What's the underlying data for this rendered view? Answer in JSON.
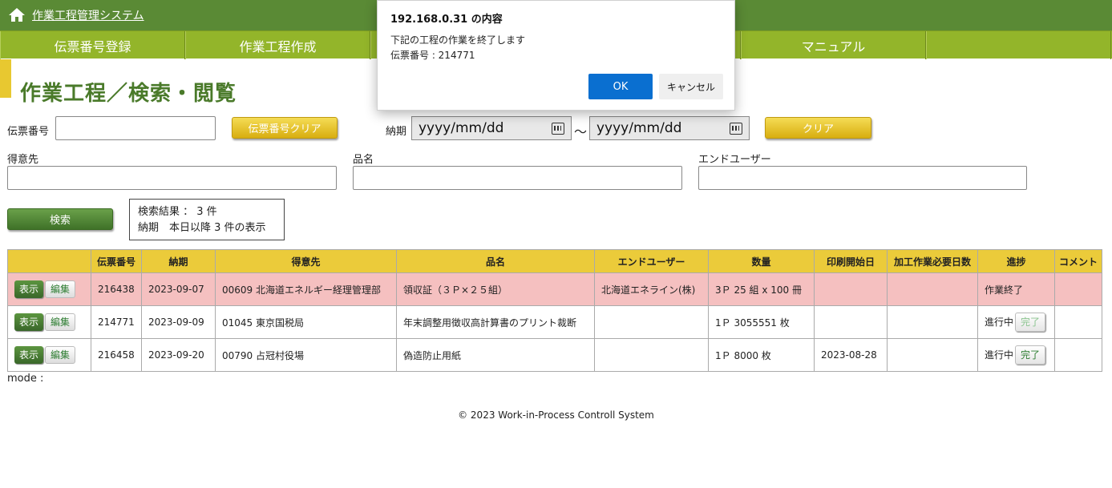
{
  "header": {
    "app_title": "作業工程管理システム"
  },
  "nav": {
    "items": [
      "伝票番号登録",
      "作業工程作成",
      "",
      "",
      "マニュアル",
      ""
    ]
  },
  "page": {
    "title": "作業工程／検索・閲覧"
  },
  "search": {
    "slip_label": "伝票番号",
    "slip_clear_label": "伝票番号クリア",
    "due_label": "納期",
    "date_from_placeholder": "yyyy/mm/dd",
    "date_to_placeholder": "yyyy/mm/dd",
    "range_sep": "～",
    "clear_label": "クリア",
    "customer_label": "得意先",
    "product_label": "品名",
    "enduser_label": "エンドユーザー",
    "search_label": "検索"
  },
  "result": {
    "line1": "検索結果 ： 3 件",
    "line2": "納期　本日以降 3 件の表示"
  },
  "table": {
    "headers": [
      "",
      "伝票番号",
      "納期",
      "得意先",
      "品名",
      "エンドユーザー",
      "数量",
      "印刷開始日",
      "加工作業必要日数",
      "進捗",
      "コメント"
    ],
    "rows": [
      {
        "show": "表示",
        "edit": "編集",
        "slip": "216438",
        "due": "2023-09-07",
        "customer": "00609 北海道エネルギー経理管理部",
        "product": "領収証（３Ｐ×２５組）",
        "enduser": "北海道エネライン(株)",
        "qty": "3Ｐ 25 組 x 100 冊",
        "print_start": "",
        "days": "",
        "progress": "作業終了",
        "done": "",
        "comment": ""
      },
      {
        "show": "表示",
        "edit": "編集",
        "slip": "214771",
        "due": "2023-09-09",
        "customer": "01045 東京国税局",
        "product": "年末調整用徴収高計算書のプリント裁断",
        "enduser": "",
        "qty": "1Ｐ 3055551 枚",
        "print_start": "",
        "days": "",
        "progress": "進行中",
        "done": "完了",
        "comment": ""
      },
      {
        "show": "表示",
        "edit": "編集",
        "slip": "216458",
        "due": "2023-09-20",
        "customer": "00790 占冠村役場",
        "product": "偽造防止用紙",
        "enduser": "",
        "qty": "1Ｐ 8000 枚",
        "print_start": "2023-08-28",
        "days": "",
        "progress": "進行中",
        "done": "完了",
        "comment": ""
      }
    ]
  },
  "mode": {
    "label": "mode :"
  },
  "footer": {
    "text": "© 2023 Work-in-Process Controll System"
  },
  "dialog": {
    "title": "192.168.0.31 の内容",
    "message_line1": "下記の工程の作業を終了します",
    "message_line2": "伝票番号 : 214771",
    "ok_label": "OK",
    "cancel_label": "キャンセル"
  },
  "colors": {
    "header_green": "#5a8a35",
    "nav_green": "#93b52a",
    "accent_yellow": "#ebcb3a",
    "done_row_pink": "#f5c0c0",
    "ok_blue": "#0a6fd0"
  }
}
